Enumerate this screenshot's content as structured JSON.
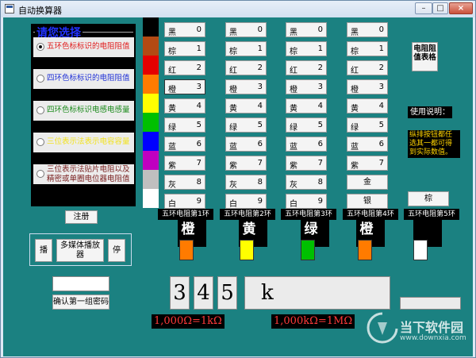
{
  "window": {
    "title": "自动换算器",
    "min": "–",
    "max": "□",
    "close": "×"
  },
  "choice": {
    "title": "请您选择",
    "options": [
      {
        "label": "五环色标标识的电阻阻值",
        "color": "#e01b1b",
        "selected": true
      },
      {
        "label": "四环色标标识的电阻阻值",
        "color": "#1e2fd6",
        "selected": false
      },
      {
        "label": "四环色标标识电感电感量",
        "color": "#1a8a1a",
        "selected": false
      },
      {
        "label": "三位表示法表示电容容量",
        "color": "#f2e21e",
        "selected": false
      },
      {
        "label": "三位表示法贴片电阻以及精密或单圈电位器电阻值",
        "color": "#7a2020",
        "selected": false
      }
    ]
  },
  "swatches": [
    {
      "name": "black",
      "color": "#000000"
    },
    {
      "name": "brown",
      "color": "#b34a14"
    },
    {
      "name": "red",
      "color": "#e50000"
    },
    {
      "name": "orange",
      "color": "#ff7b00"
    },
    {
      "name": "yellow",
      "color": "#ffff00"
    },
    {
      "name": "green",
      "color": "#00c000"
    },
    {
      "name": "blue",
      "color": "#0000ff"
    },
    {
      "name": "violet",
      "color": "#c000c0"
    },
    {
      "name": "gray",
      "color": "#bfbfbf"
    },
    {
      "name": "white",
      "color": "#ffffff"
    }
  ],
  "color_table": [
    {
      "name": "黑",
      "value": "0"
    },
    {
      "name": "棕",
      "value": "1"
    },
    {
      "name": "红",
      "value": "2"
    },
    {
      "name": "橙",
      "value": "3"
    },
    {
      "name": "黄",
      "value": "4"
    },
    {
      "name": "绿",
      "value": "5"
    },
    {
      "name": "蓝",
      "value": "6"
    },
    {
      "name": "紫",
      "value": "7"
    },
    {
      "name": "灰",
      "value": "8"
    },
    {
      "name": "白",
      "value": "9"
    }
  ],
  "col4_special": {
    "gold": "金",
    "silver": "银"
  },
  "col5_special": {
    "brown": "棕"
  },
  "rings": [
    {
      "label": "五环电阻第1环",
      "name": "橙",
      "color": "#ff7b00"
    },
    {
      "label": "五环电阻第2环",
      "name": "黄",
      "color": "#ffff00"
    },
    {
      "label": "五环电阻第3环",
      "name": "绿",
      "color": "#00c000"
    },
    {
      "label": "五环电阻第4环",
      "name": "橙",
      "color": "#ff7b00"
    },
    {
      "label": "五环电阻第5环",
      "name": "",
      "color": "#ffffff"
    }
  ],
  "table_button": "电阻阻值表格",
  "help": {
    "label": "使用说明：",
    "text": "纵排按钮都任选其一都可得到实际数值。"
  },
  "register_button": "注册",
  "media": {
    "play": "播",
    "player": "多媒体播放器",
    "stop": "停"
  },
  "password": {
    "value": "",
    "confirm_button": "确认第一组密码"
  },
  "result": {
    "d1": "3",
    "d2": "4",
    "d3": "5",
    "unit": "k"
  },
  "formulas": {
    "f1": "1,000Ω=1kΩ",
    "f2": "1,000kΩ=1MΩ"
  },
  "watermark": {
    "line1": "当下软件园",
    "line2": "www.downxia.com"
  }
}
